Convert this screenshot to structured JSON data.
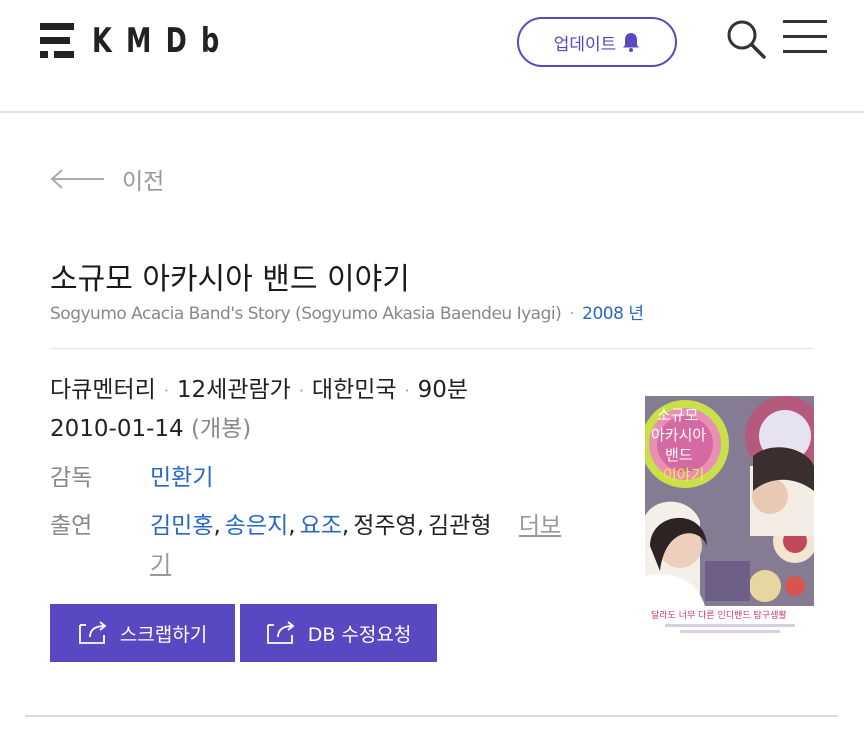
{
  "header": {
    "logo_text": "KMDb",
    "update_label": "업데이트",
    "icons": {
      "bell": "bell-icon",
      "search": "search-icon",
      "menu": "menu-icon"
    },
    "accent_color": "#5848c2"
  },
  "back_label": "이전",
  "movie": {
    "title": "소규모 아카시아 밴드 이야기",
    "subtitle": "Sogyumo Acacia Band's Story (Sogyumo Akasia Baendeu Iyagi)",
    "year": "2008 년",
    "genre": "다큐멘터리",
    "rating": "12세관람가",
    "country": "대한민국",
    "runtime": "90분",
    "release_date": "2010-01-14",
    "release_note": "(개봉)",
    "director_label": "감독",
    "director": "민환기",
    "cast_label": "출연",
    "cast_linked": [
      "김민홍",
      "송은지",
      "요조"
    ],
    "cast_plain": [
      "정주영",
      "김관형"
    ],
    "more_label_1": "더보",
    "more_label_2": "기"
  },
  "buttons": {
    "scrap": "스크랩하기",
    "db_request": "DB 수정요청"
  },
  "poster": {
    "title_lines": [
      "소규모",
      "아카시아",
      "밴드",
      "이야기"
    ],
    "tagline": "달라도 너무 다른 인디밴드 탐구생활"
  }
}
